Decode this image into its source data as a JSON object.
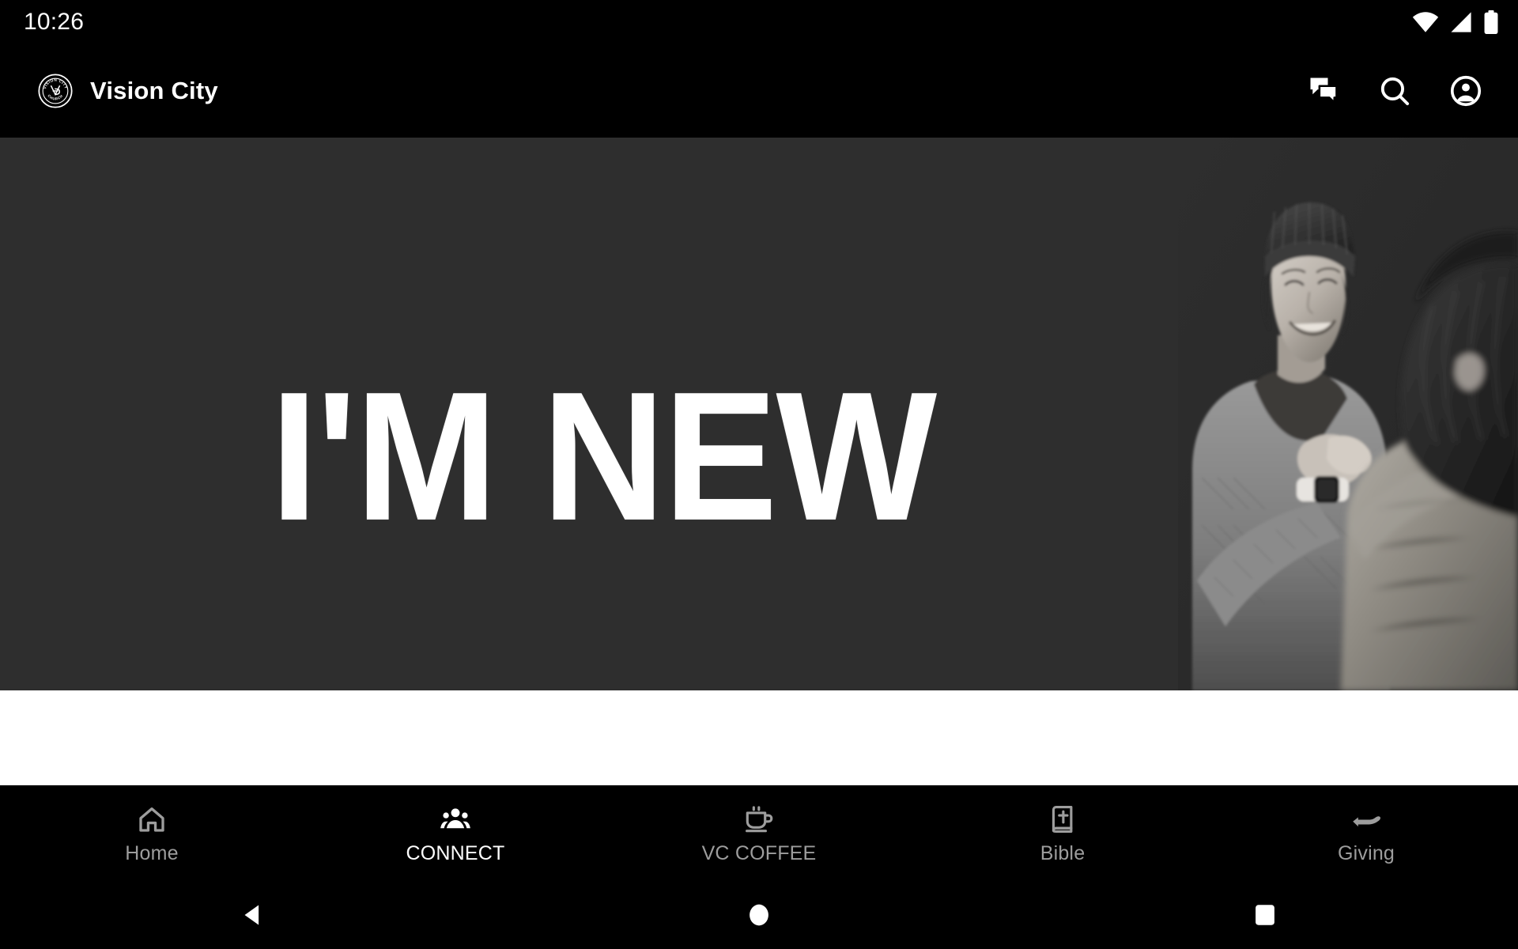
{
  "status_bar": {
    "time": "10:26",
    "icons": [
      "wifi-icon",
      "cellular-signal-icon",
      "battery-icon"
    ]
  },
  "app_header": {
    "logo": "vision-city-church-seal-logo",
    "logo_text_top": "VISION CITY",
    "logo_text_bottom": "CHURCH",
    "logo_monogram": "VC",
    "title": "Vision City",
    "actions": [
      {
        "name": "messages-icon",
        "label": "Messages"
      },
      {
        "name": "search-icon",
        "label": "Search"
      },
      {
        "name": "account-circle-icon",
        "label": "Account"
      }
    ]
  },
  "hero": {
    "title": "I'M NEW",
    "background_color": "#2e2e2e",
    "title_color": "#ffffff",
    "photo_description": "Black and white photo of two people greeting each other, one wearing a beanie and smiling"
  },
  "bottom_nav": {
    "active_index": 1,
    "active_color": "#ffffff",
    "inactive_color": "#9d9d9d",
    "items": [
      {
        "label": "Home",
        "icon": "home-icon",
        "active": false
      },
      {
        "label": "CONNECT",
        "icon": "groups-icon",
        "active": true
      },
      {
        "label": "VC COFFEE",
        "icon": "coffee-icon",
        "active": false
      },
      {
        "label": "Bible",
        "icon": "bible-icon",
        "active": false
      },
      {
        "label": "Giving",
        "icon": "giving-hand-icon",
        "active": false
      }
    ]
  },
  "system_nav": {
    "buttons": [
      {
        "name": "back-button",
        "icon": "triangle-left-icon"
      },
      {
        "name": "home-button",
        "icon": "circle-icon"
      },
      {
        "name": "recents-button",
        "icon": "square-icon"
      }
    ]
  }
}
